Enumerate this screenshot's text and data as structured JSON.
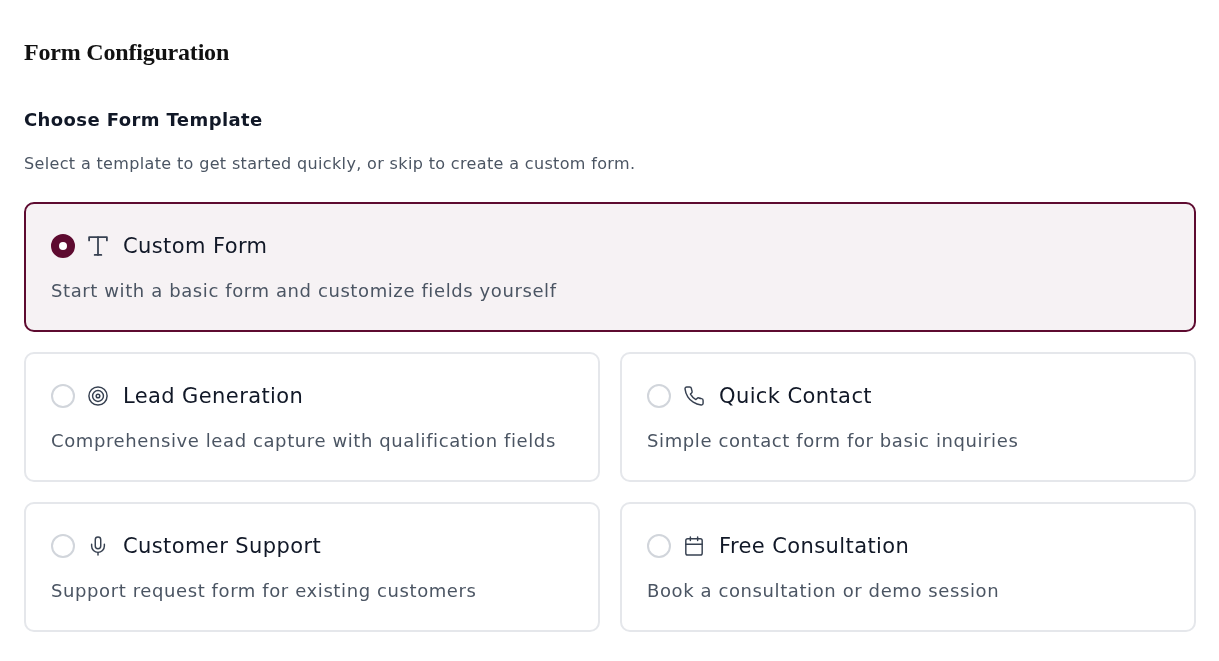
{
  "page": {
    "title": "Form Configuration"
  },
  "section": {
    "heading": "Choose Form Template",
    "description": "Select a template to get started quickly, or skip to create a custom form."
  },
  "templates": [
    {
      "title": "Custom Form",
      "description": "Start with a basic form and customize fields yourself",
      "selected": true
    },
    {
      "title": "Lead Generation",
      "description": "Comprehensive lead capture with qualification fields",
      "selected": false
    },
    {
      "title": "Quick Contact",
      "description": "Simple contact form for basic inquiries",
      "selected": false
    },
    {
      "title": "Customer Support",
      "description": "Support request form for existing customers",
      "selected": false
    },
    {
      "title": "Free Consultation",
      "description": "Book a consultation or demo session",
      "selected": false
    }
  ]
}
